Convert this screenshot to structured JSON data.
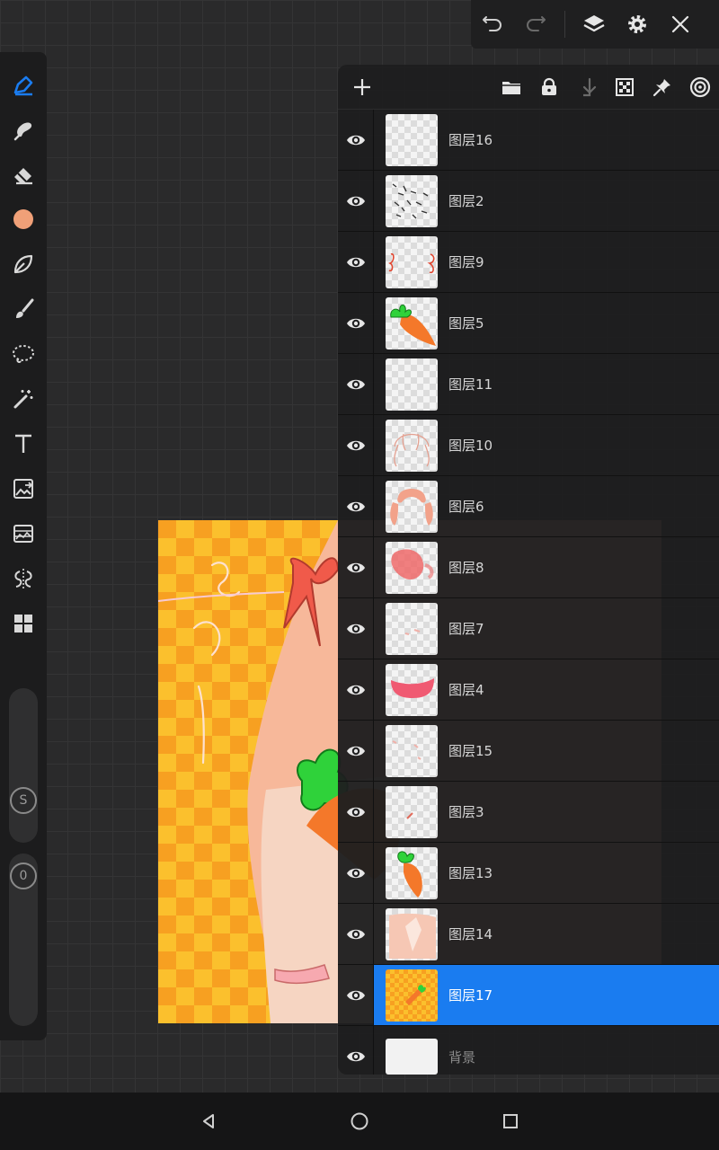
{
  "top_bar": {
    "icons": [
      "undo-icon",
      "redo-icon",
      "layers-icon",
      "settings-icon",
      "close-icon"
    ]
  },
  "toolbar": {
    "tools": [
      "pencil-icon",
      "smudge-icon",
      "eraser-icon",
      "color-swatch",
      "lasso-fill-icon",
      "brush-icon",
      "lasso-select-icon",
      "magic-wand-icon",
      "text-icon",
      "image-import-icon",
      "adjust-icon",
      "symmetry-icon",
      "apps-icon"
    ],
    "active_color": "#f0a078",
    "size_slider_label": "S",
    "opacity_slider_label": "0"
  },
  "layers_panel": {
    "header_icons": [
      "add-layer-icon",
      "folder-icon",
      "lock-icon",
      "merge-down-icon",
      "alpha-lock-icon",
      "pin-icon",
      "target-icon"
    ],
    "layers": [
      {
        "name": "图层16",
        "selected": false
      },
      {
        "name": "图层2",
        "selected": false
      },
      {
        "name": "图层9",
        "selected": false
      },
      {
        "name": "图层5",
        "selected": false
      },
      {
        "name": "图层11",
        "selected": false
      },
      {
        "name": "图层10",
        "selected": false
      },
      {
        "name": "图层6",
        "selected": false
      },
      {
        "name": "图层8",
        "selected": false
      },
      {
        "name": "图层7",
        "selected": false
      },
      {
        "name": "图层4",
        "selected": false
      },
      {
        "name": "图层15",
        "selected": false
      },
      {
        "name": "图层3",
        "selected": false
      },
      {
        "name": "图层13",
        "selected": false
      },
      {
        "name": "图层14",
        "selected": false
      },
      {
        "name": "图层17",
        "selected": true
      },
      {
        "name": "背景",
        "selected": false
      }
    ],
    "selected_color": "#1a7cf0"
  },
  "nav_bar": {
    "icons": [
      "back-icon",
      "home-icon",
      "recents-icon"
    ]
  }
}
